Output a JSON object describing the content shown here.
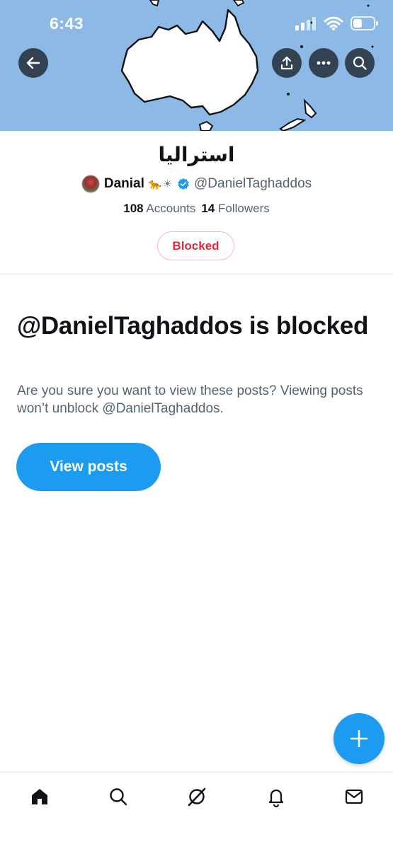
{
  "status_bar": {
    "time": "6:43"
  },
  "profile": {
    "display_title": "استراليا",
    "owner_name": "Danial",
    "owner_emoji": "🐆☀",
    "handle": "@DanielTaghaddos",
    "accounts_count": "108",
    "accounts_label": "Accounts",
    "followers_count": "14",
    "followers_label": "Followers",
    "blocked_label": "Blocked"
  },
  "blocked_notice": {
    "title": "@DanielTaghaddos is blocked",
    "description": "Are you sure you want to view these posts? Viewing posts won’t unblock @DanielTaghaddos.",
    "view_button": "View posts"
  },
  "colors": {
    "accent": "#1d9bf0",
    "blocked": "#e2293b",
    "banner_sky": "#8db9e6"
  },
  "icons": {
    "back": "arrow-left-icon",
    "share": "share-icon",
    "more": "more-icon",
    "search": "search-icon",
    "compose": "plus-icon",
    "tabs": [
      "home-icon",
      "search-icon",
      "grok-icon",
      "bell-icon",
      "mail-icon"
    ]
  }
}
